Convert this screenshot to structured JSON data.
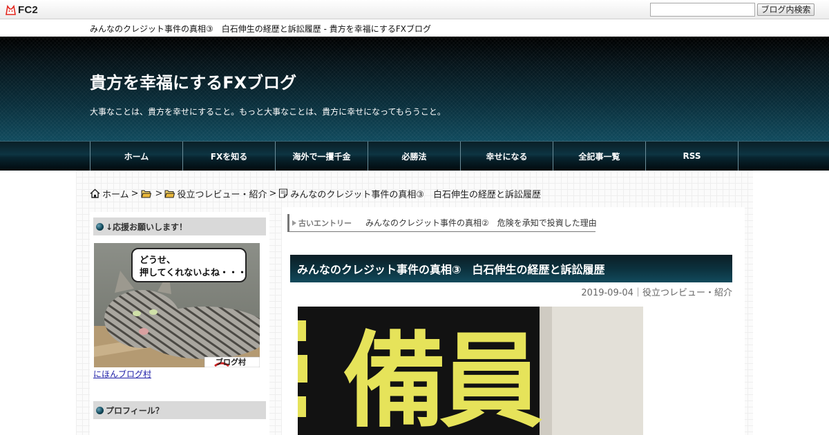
{
  "fc2bar": {
    "logo_text": "FC2",
    "search_value": "",
    "search_button": "ブログ内検索"
  },
  "page_title": "みんなのクレジット事件の真相③　白石伸生の経歴と訴訟履歴 - 貴方を幸福にするFXブログ",
  "header": {
    "blog_title": "貴方を幸福にするFXブログ",
    "description": "大事なことは、貴方を幸せにすること。もっと大事なことは、貴方に幸せになってもらうこと。"
  },
  "nav": {
    "items": [
      "ホーム",
      "FXを知る",
      "海外で一攫千金",
      "必勝法",
      "幸せになる",
      "全記事一覧",
      "RSS"
    ]
  },
  "breadcrumb": {
    "home": "ホーム",
    "sep": ">",
    "category": "役立つレビュー・紹介",
    "current": "みんなのクレジット事件の真相③　白石伸生の経歴と訴訟履歴"
  },
  "sidebar": {
    "support_heading": "↓応援お願いします！",
    "banner_bubble_line1": "どうせ、",
    "banner_bubble_line2": "押してくれないよね・・・",
    "banner_tag": "ブログ村",
    "banner_link": "にほんブログ村",
    "profile_heading": "プロフィール？"
  },
  "content": {
    "old_entry_label": "古いエントリー",
    "old_entry_link": "みんなのクレジット事件の真相②　危険を承知で投資した理由",
    "entry_title": "みんなのクレジット事件の真相③　白石伸生の経歴と訴訟履歴",
    "entry_date": "2019-09-04",
    "entry_meta_sep": "｜",
    "entry_category": "役立つレビュー・紹介",
    "image_chars": [
      "備",
      "員"
    ]
  },
  "colors": {
    "header_dark": "#0a2f3c",
    "nav_dark": "#0d3442",
    "link_blue": "#1a1aa6",
    "sign_yellow": "#e6e35a"
  }
}
